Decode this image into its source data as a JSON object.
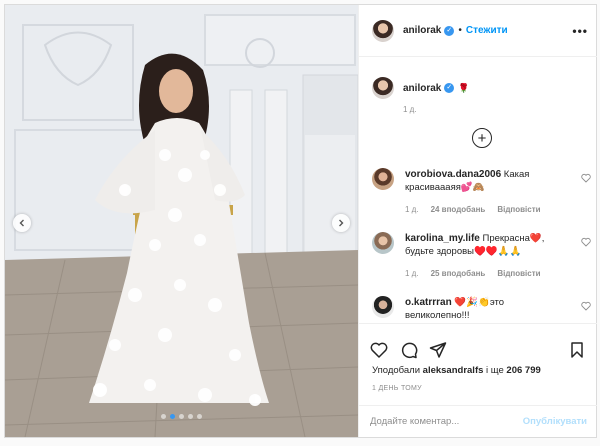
{
  "post": {
    "author": "anilorak",
    "follow_label": "Стежити",
    "follow_separator": "•",
    "more_label": "•••",
    "caption_emoji": "🌹",
    "caption_time": "1 д.",
    "load_more_label": "+"
  },
  "comments": [
    {
      "username": "vorobiova.dana2006",
      "text": "Какая красиваааяя💕🙈",
      "time": "1 д.",
      "likes": "24 вподобань",
      "reply": "Відповісти"
    },
    {
      "username": "karolina_my.life",
      "text": "Прекрасна❤️, будьте здоровы♥️♥️🙏🙏",
      "time": "1 д.",
      "likes": "25 вподобань",
      "reply": "Відповісти"
    },
    {
      "username": "o.katrrran",
      "text": "❤️🎉👏это великолепно!!!",
      "time": "",
      "likes": "",
      "reply": ""
    }
  ],
  "engagement": {
    "liked_by_prefix": "Уподобали",
    "liked_by_user": "aleksandralfs",
    "liked_by_connector": "і ще",
    "liked_by_count": "206 799",
    "timestamp": "1 день тому"
  },
  "composer": {
    "placeholder": "Додайте коментар...",
    "publish_label": "Опублікувати"
  },
  "carousel": {
    "total_slides": 5,
    "active_slide": 2
  },
  "colors": {
    "accent": "#0095f6",
    "verified": "#3897f0",
    "publish_disabled": "#b2dffc"
  }
}
